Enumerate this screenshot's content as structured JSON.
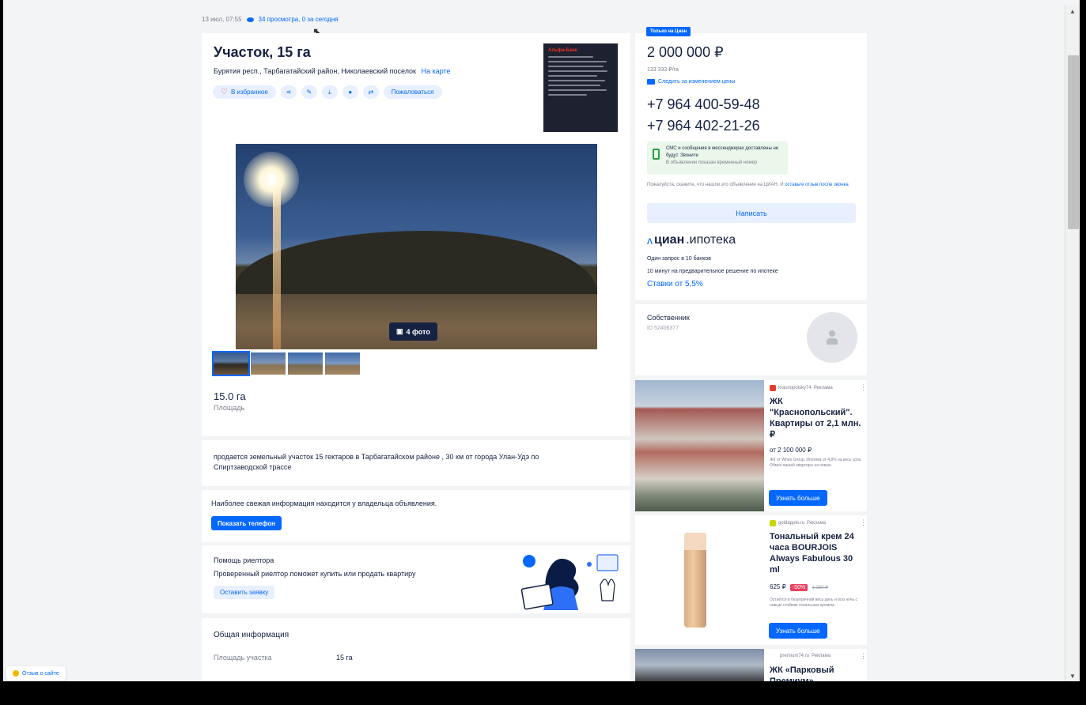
{
  "meta": {
    "date": "13 июл, 07:55",
    "views": "34 просмотра, 0 за сегодня"
  },
  "listing": {
    "title": "Участок, 15 га",
    "address": "Бурятия респ., Тарбагатайский район, Николаевский поселок",
    "map_link": "На карте",
    "favorite_label": "В избранное",
    "report_label": "Пожаловаться",
    "photo_count": "4 фото",
    "area_value": "15.0 га",
    "area_label": "Площадь",
    "ad_brand": "Альфа-Банк"
  },
  "description": "продается земельный участок 15 гектаров в Тарбагатайском районе , 30 км от города Улан-Удэ по Спиртзаводской трассе",
  "fresh_info": {
    "text": "Наиболее свежая информация находится у владельца объявления.",
    "button": "Показать телефон"
  },
  "realtor": {
    "title": "Помощь риелтора",
    "subtitle": "Проверенный риелтор поможет купить или продать квартиру",
    "button": "Оставить заявку"
  },
  "general_info": {
    "title": "Общая информация",
    "rows": [
      {
        "label": "Площадь участка",
        "value": "15 га"
      }
    ]
  },
  "feedback_label": "Отзыв о сайте",
  "price_block": {
    "badge": "Только на Циан",
    "price": "2 000 000 ₽",
    "price_per": "133 333 ₽/га",
    "track_label": "Следить за изменением цены",
    "phones": [
      "+7 964 400-59-48",
      "+7 964 402-21-26"
    ],
    "sms_text": "СМС и сообщения в мессенджерах доставлены не будут. Звоните",
    "sms_note": "В объявлении показан временный номер",
    "notice": "Пожалуйста, скажите, что нашли это объявление на ЦИАН. И",
    "notice_link": "оставьте отзыв после звонка",
    "write_button": "Написать"
  },
  "mortgage": {
    "logo_main": "циан",
    "logo_sub": ".ипотека",
    "line1": "Один запрос в 10 банков",
    "line2": "10 минут на предварительное решение по ипотеке",
    "rates": "Ставки от 5,5%"
  },
  "owner": {
    "title": "Собственник",
    "id": "ID 52406377"
  },
  "ads": [
    {
      "source": "krasnopolsky74",
      "source_tag": "Реклама",
      "title": "ЖК \"Краснопольский\". Квартиры от 2,1 млн. ₽",
      "price": "от 2 100 000 ₽",
      "small": "ЖК от Whoo Group. Ипотека от 4,8% на весь срок. Обмен вашей квартиры на новую.",
      "button": "Узнать больше"
    },
    {
      "source": "goldapple.ru",
      "source_tag": "Реклама",
      "title": "Тональный крем 24 часа BOURJOIS Always Fabulous 30 ml",
      "price": "625 ₽",
      "discount": "-50%",
      "old_price": "1 250 ₽",
      "small": "Остаётся в безупречной весь день и всю ночь с новым стойким тональным кремом.",
      "button": "Узнать больше"
    },
    {
      "source": "premium74.ru",
      "source_tag": "Реклама",
      "title": "ЖК «Парковый Премиум»"
    }
  ]
}
